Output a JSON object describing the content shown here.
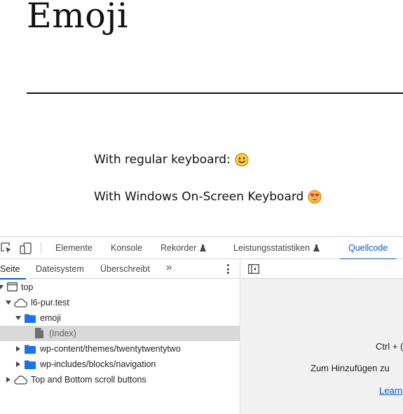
{
  "page": {
    "title": "Emoji",
    "paragraph1": "With regular keyboard:",
    "paragraph1_emoji": "slightly-smiling-face",
    "paragraph2": "With Windows On-Screen Keyboard",
    "paragraph2_emoji": "heart-eyes-face"
  },
  "devtools": {
    "tabs": [
      {
        "label": "Elemente"
      },
      {
        "label": "Konsole"
      },
      {
        "label": "Rekorder",
        "experimental": true
      },
      {
        "label": "Leistungsstatistiken",
        "experimental": true
      },
      {
        "label": "Quellcode",
        "active": true
      }
    ],
    "sources": {
      "nav_tabs": [
        {
          "label": "Seite",
          "active": true
        },
        {
          "label": "Dateisystem"
        },
        {
          "label": "Überschreibt"
        }
      ],
      "more_tabs": "»",
      "tree": [
        {
          "label": "top",
          "icon": "frame-icon",
          "expanded": true
        },
        {
          "label": "l6-pur.test",
          "icon": "cloud-icon",
          "expanded": true
        },
        {
          "label": "emoji",
          "icon": "folder-icon",
          "expanded": true
        },
        {
          "label": "(Index)",
          "icon": "file-icon",
          "selected": true
        },
        {
          "label": "wp-content/themes/twentytwentytwo",
          "icon": "folder-icon",
          "expanded": false
        },
        {
          "label": "wp-includes/blocks/navigation",
          "icon": "folder-icon",
          "expanded": false
        },
        {
          "label": "Top and Bottom scroll buttons",
          "icon": "cloud-icon",
          "expanded": false
        }
      ],
      "editor_hints": {
        "shortcut": "Ctrl + (",
        "add_folder": "Zum Hinzufügen zu",
        "learn_more": "Learn"
      }
    }
  },
  "colors": {
    "accent": "#0b57d0",
    "folder": "#1a73e8",
    "selected_row": "#d9d9d9",
    "editor_bg": "#f1f1f1"
  }
}
